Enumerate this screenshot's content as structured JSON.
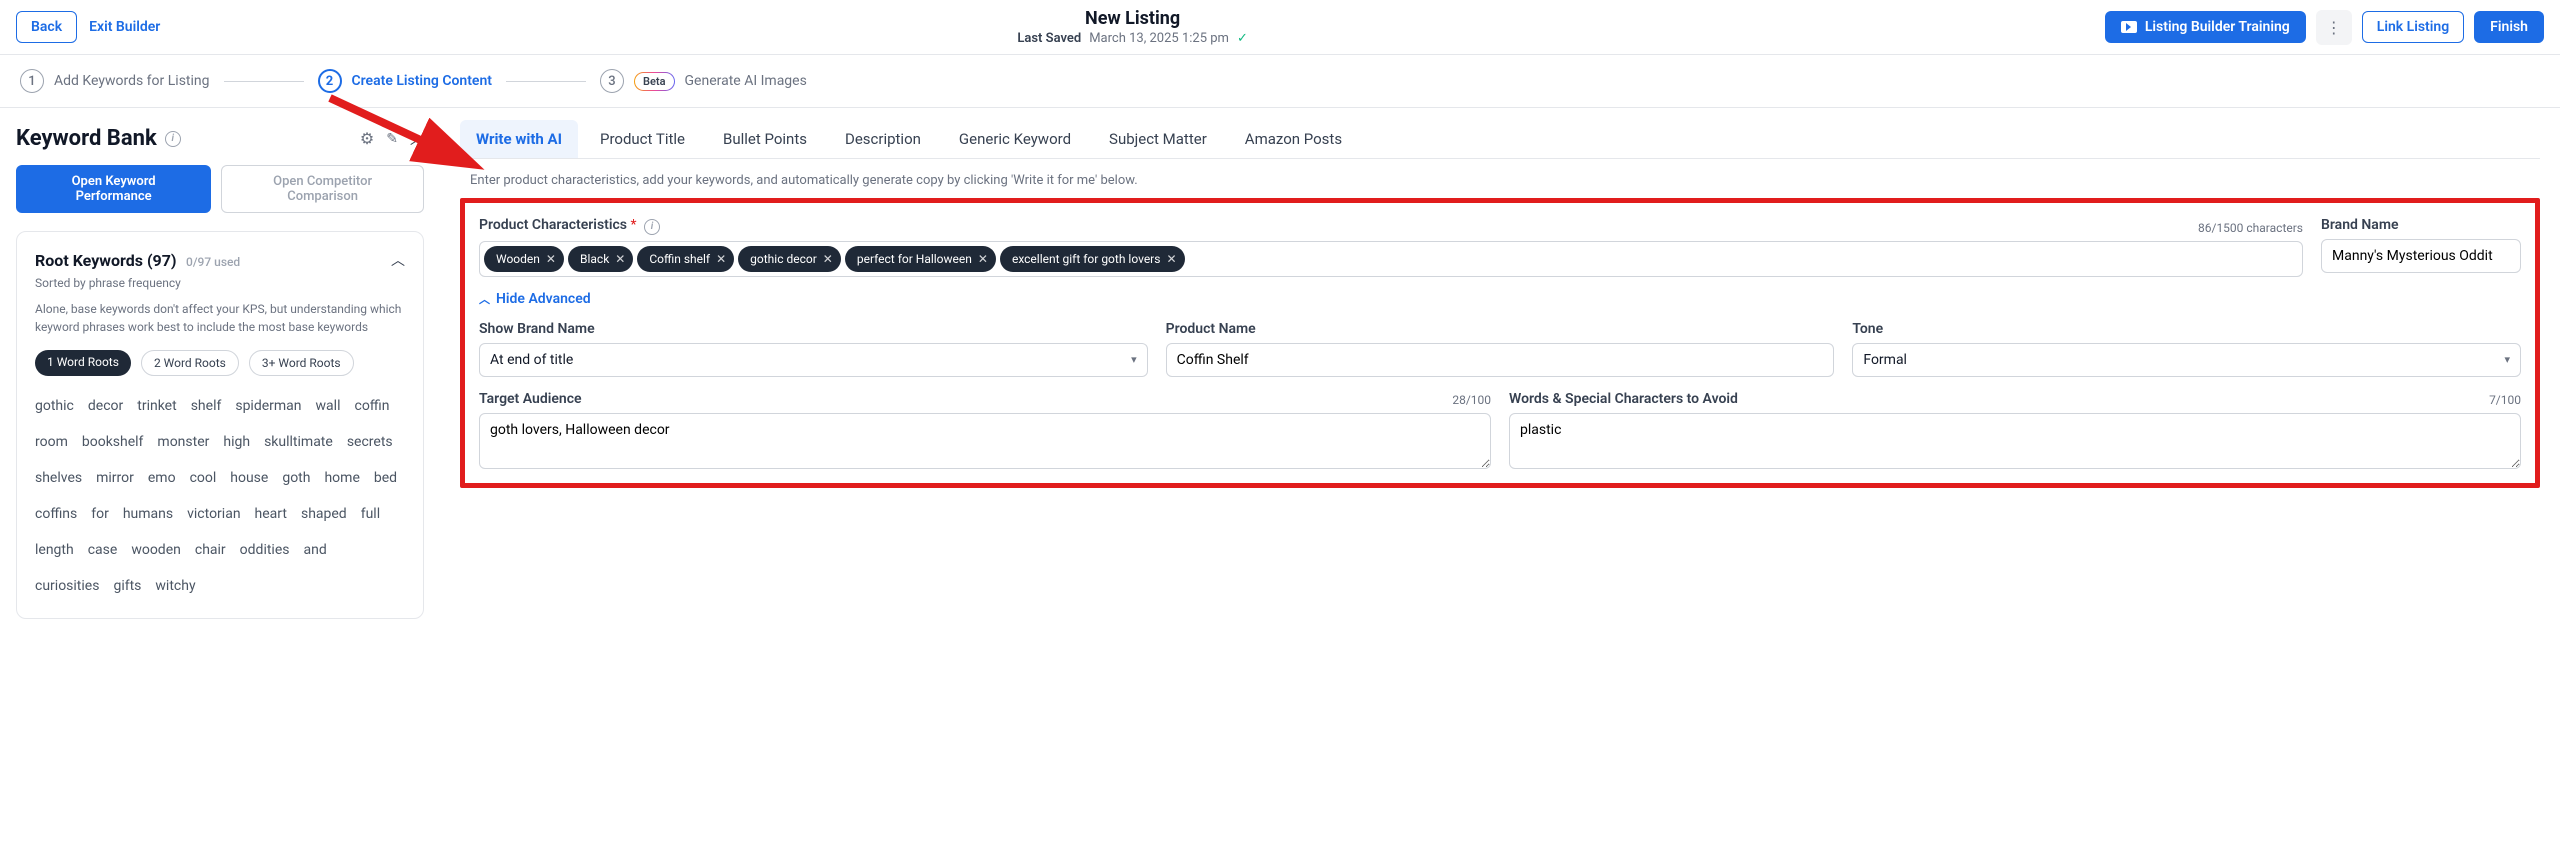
{
  "header": {
    "back": "Back",
    "exit": "Exit Builder",
    "title": "New Listing",
    "saved_label": "Last Saved",
    "saved_time": "March 13, 2025 1:25 pm",
    "training": "Listing Builder Training",
    "link": "Link Listing",
    "finish": "Finish"
  },
  "steps": {
    "s1": "Add Keywords for Listing",
    "s2": "Create Listing Content",
    "s3": "Generate AI Images",
    "beta": "Beta"
  },
  "sidebar": {
    "title": "Keyword Bank",
    "open_perf": "Open Keyword Performance",
    "open_comp": "Open Competitor Comparison",
    "panel_title": "Root Keywords (97)",
    "panel_count": "0/97 used",
    "panel_sub": "Sorted by phrase frequency",
    "panel_desc": "Alone, base keywords don't affect your KPS, but understanding which keyword phrases work best to include the most base keywords",
    "root_pills": [
      "1 Word Roots",
      "2 Word Roots",
      "3+ Word Roots"
    ],
    "keywords": [
      "gothic",
      "decor",
      "trinket",
      "shelf",
      "spiderman",
      "wall",
      "coffin",
      "room",
      "bookshelf",
      "monster",
      "high",
      "skulltimate",
      "secrets",
      "shelves",
      "mirror",
      "emo",
      "cool",
      "house",
      "goth",
      "home",
      "bed",
      "coffins",
      "for",
      "humans",
      "victorian",
      "heart",
      "shaped",
      "full",
      "length",
      "case",
      "wooden",
      "chair",
      "oddities",
      "and",
      "curiosities",
      "gifts",
      "witchy"
    ]
  },
  "tabs": [
    "Write with AI",
    "Product Title",
    "Bullet Points",
    "Description",
    "Generic Keyword",
    "Subject Matter",
    "Amazon Posts"
  ],
  "helper": "Enter product characteristics, add your keywords, and automatically generate copy by clicking 'Write it for me' below.",
  "form": {
    "characteristics_label": "Product Characteristics",
    "characteristics_counter": "86/1500 characters",
    "chips": [
      "Wooden",
      "Black",
      "Coffin shelf",
      "gothic decor",
      "perfect for Halloween",
      "excellent gift for goth lovers"
    ],
    "brand_label": "Brand Name",
    "brand_value": "Manny's Mysterious Oddit",
    "hide_advanced": "Hide Advanced",
    "show_brand_label": "Show Brand Name",
    "show_brand_value": "At end of title",
    "product_name_label": "Product Name",
    "product_name_value": "Coffin Shelf",
    "tone_label": "Tone",
    "tone_value": "Formal",
    "target_label": "Target Audience",
    "target_counter": "28/100",
    "target_value": "goth lovers, Halloween decor",
    "avoid_label": "Words & Special Characters to Avoid",
    "avoid_counter": "7/100",
    "avoid_value": "plastic"
  }
}
